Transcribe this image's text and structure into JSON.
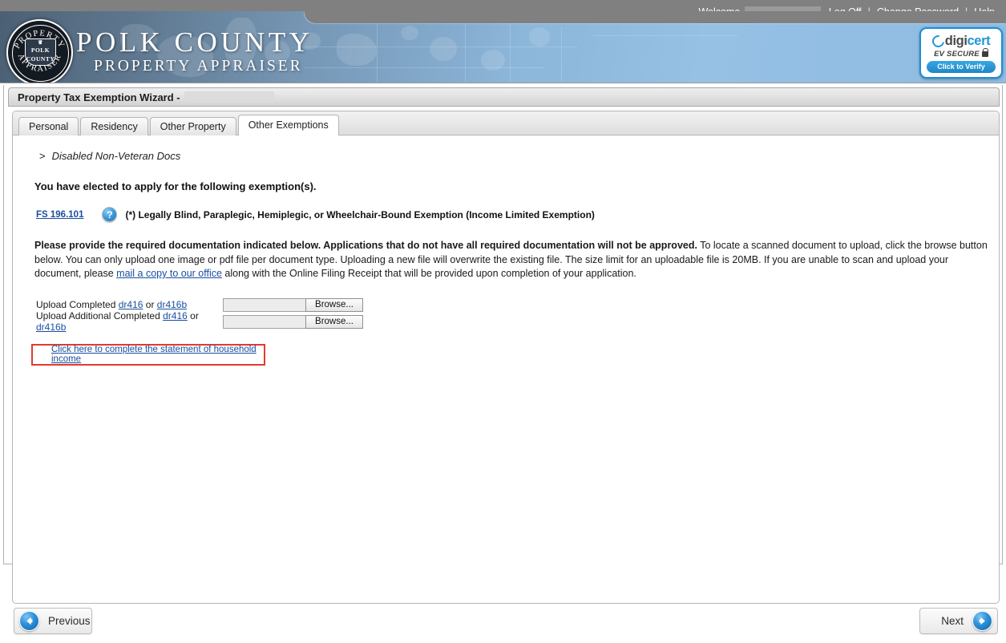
{
  "topbar": {
    "welcome_label": "Welcome,",
    "log_off": "Log Off",
    "change_password": "Change Password",
    "help": "Help",
    "separator": "|"
  },
  "banner": {
    "title_line1": "POLK COUNTY",
    "title_line2": "PROPERTY APPRAISER",
    "seal": {
      "arc_top": "PROPERTY",
      "arc_bottom": "APPRAISER",
      "shield_line1": "POLK",
      "shield_line2": "COUNTY",
      "crown": "♛"
    },
    "digicert": {
      "brand_part1": "digi",
      "brand_part2": "cert",
      "ev_secure": "EV SECURE",
      "verify": "Click to Verify"
    }
  },
  "wizard": {
    "title": "Property Tax Exemption Wizard -",
    "tabs": [
      {
        "label": "Personal",
        "active": false
      },
      {
        "label": "Residency",
        "active": false
      },
      {
        "label": "Other Property",
        "active": false
      },
      {
        "label": "Other Exemptions",
        "active": true
      }
    ],
    "breadcrumb_chevron": ">",
    "breadcrumb": "Disabled Non-Veteran Docs",
    "elected_heading": "You have elected to apply for the following exemption(s).",
    "exemption": {
      "statute_link": "FS 196.101",
      "help_icon_glyph": "?",
      "description": "(*) Legally Blind, Paraplegic, Hemiplegic, or Wheelchair-Bound Exemption (Income Limited Exemption)"
    },
    "instructions": {
      "bold_part": "Please provide the required documentation indicated below. Applications that do not have all required documentation will not be approved.",
      "text_part1": " To locate a scanned document to upload, click the browse button below. You can only upload one image or pdf file per document type. Uploading a new file will overwrite the existing file. The size limit for an uploadable file is 20MB. If you are unable to scan and upload your document, please ",
      "mail_link": "mail a copy to our office",
      "text_part2": " along with the Online Filing Receipt that will be provided upon completion of your application."
    },
    "uploads": [
      {
        "label_prefix": "Upload Completed ",
        "link1": "dr416",
        "conjunction": " or ",
        "link2": "dr416b",
        "value": "",
        "browse_label": "Browse..."
      },
      {
        "label_prefix": "Upload Additional Completed ",
        "link1": "dr416",
        "conjunction": " or ",
        "link2": "dr416b",
        "value": "",
        "browse_label": "Browse..."
      }
    ],
    "household_link": "Click here to complete the statement of household income",
    "highlight_color": "#e03c31"
  },
  "footer": {
    "previous_label": "Previous",
    "next_label": "Next"
  }
}
